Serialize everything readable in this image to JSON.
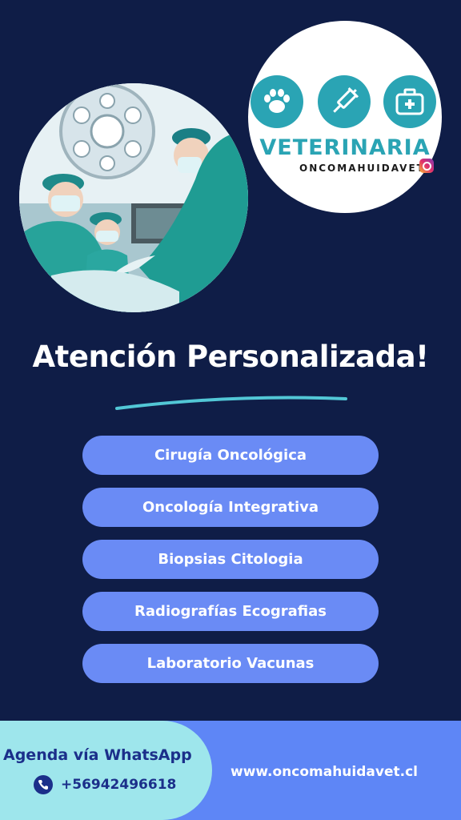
{
  "logo": {
    "title": "VETERINARIA",
    "handle": "ONCOMAHUIDAVET",
    "icons": [
      "paw-icon",
      "syringe-icon",
      "medical-kit-icon"
    ],
    "accent_color": "#2aa4b4"
  },
  "heading": "Atención Personalizada!",
  "services": [
    "Cirugía Oncológica",
    "Oncología Integrativa",
    "Biopsias  Citologia",
    "Radiografías  Ecografias",
    "Laboratorio  Vacunas"
  ],
  "footer": {
    "agenda_label": "Agenda vía WhatsApp",
    "phone": "+56942496618",
    "website": "www.oncomahuidavet.cl"
  },
  "colors": {
    "background": "#0f1d47",
    "pill": "#6a8bf5",
    "footer_left": "#9ee6ec",
    "footer_right": "#5e86f6",
    "footer_text": "#1b2f8a"
  }
}
